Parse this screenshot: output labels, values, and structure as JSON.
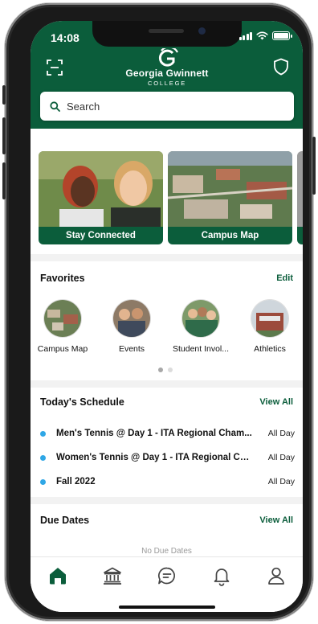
{
  "status_bar": {
    "time": "14:08"
  },
  "header": {
    "logo_name": "Georgia Gwinnett",
    "logo_sub": "COLLEGE",
    "accent_color": "#0b5d3b",
    "left_icon": "qr-scan-icon",
    "right_icon": "shield-icon"
  },
  "search": {
    "placeholder": "Search"
  },
  "cards": [
    {
      "label": "Stay Connected"
    },
    {
      "label": "Campus Map"
    }
  ],
  "favorites": {
    "title": "Favorites",
    "edit_label": "Edit",
    "items": [
      {
        "label": "Campus Map"
      },
      {
        "label": "Events"
      },
      {
        "label": "Student Invol..."
      },
      {
        "label": "Athletics"
      }
    ],
    "page_indicator": {
      "current": 1,
      "total": 2
    }
  },
  "schedule": {
    "title": "Today's Schedule",
    "view_all_label": "View All",
    "events": [
      {
        "title": "Men's Tennis @ Day 1 - ITA Regional Cham...",
        "time": "All Day",
        "dot_color": "#2fa7e6"
      },
      {
        "title": "Women's Tennis @ Day 1 - ITA Regional Ch...",
        "time": "All Day",
        "dot_color": "#2fa7e6"
      },
      {
        "title": "Fall 2022",
        "time": "All Day",
        "dot_color": "#2fa7e6"
      }
    ]
  },
  "due_dates": {
    "title": "Due Dates",
    "view_all_label": "View All",
    "empty_text": "No Due Dates"
  },
  "tab_bar": {
    "tabs": [
      "home-icon",
      "institution-icon",
      "chat-icon",
      "bell-icon",
      "profile-icon"
    ],
    "active": "home-icon"
  }
}
